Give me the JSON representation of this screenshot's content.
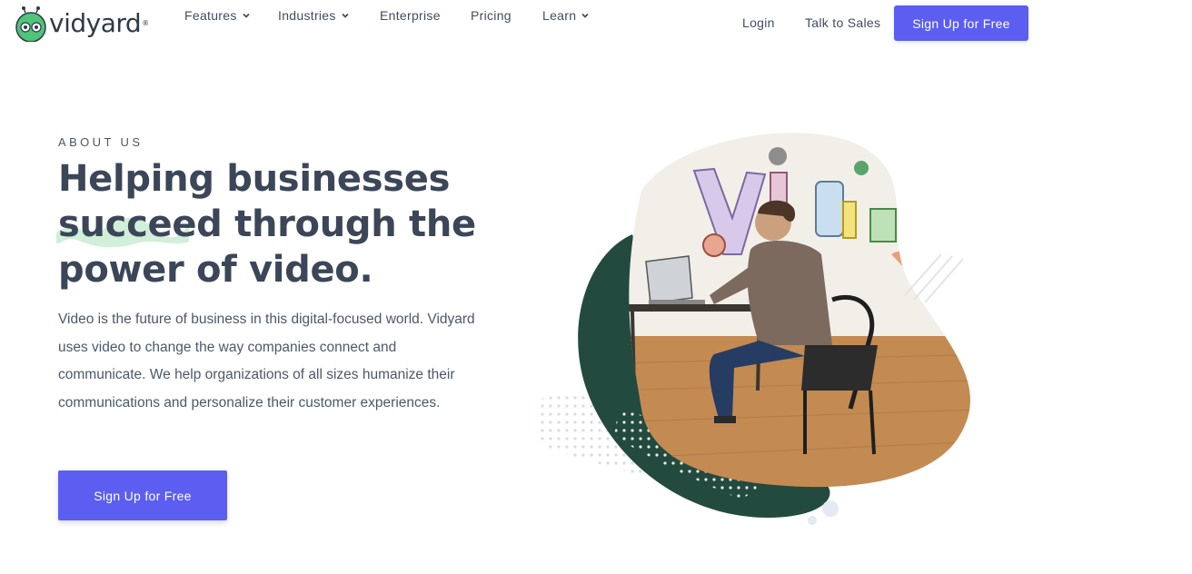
{
  "brand": {
    "name": "vidyard",
    "registered_mark": "®",
    "colors": {
      "accent": "#5b5ef0",
      "logo_green": "#4fc47a",
      "text_dark": "#3b4658",
      "blob_green": "#234a3e"
    }
  },
  "nav": {
    "items": [
      {
        "label": "Features",
        "has_dropdown": true
      },
      {
        "label": "Industries",
        "has_dropdown": true
      },
      {
        "label": "Enterprise",
        "has_dropdown": false
      },
      {
        "label": "Pricing",
        "has_dropdown": false
      },
      {
        "label": "Learn",
        "has_dropdown": true
      }
    ],
    "login": "Login",
    "talk_to_sales": "Talk to Sales",
    "signup": "Sign Up for Free"
  },
  "hero": {
    "eyebrow": "ABOUT US",
    "headline": {
      "line1": "Helping businesses",
      "line2_highlight": "succeed",
      "line2_rest": " through the",
      "line3": "power of video."
    },
    "body": "Video is the future of business in this digital-focused world. Vidyard uses video to change the way companies connect and communicate. We help organizations of all sizes humanize their communications and personalize their customer experiences.",
    "cta": "Sign Up for Free",
    "image_icon": "person-working-at-laptop-photo"
  }
}
